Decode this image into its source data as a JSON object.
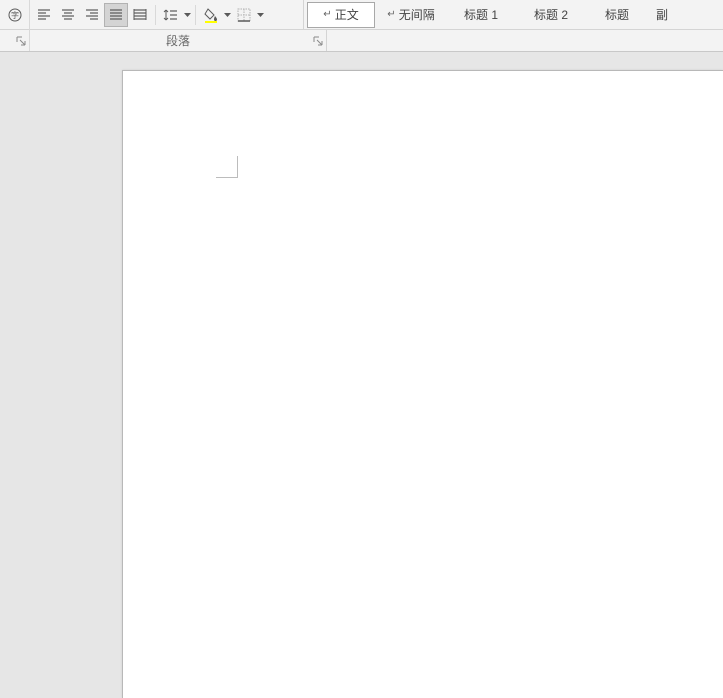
{
  "paragraph_group": {
    "label": "段落"
  },
  "styles": [
    {
      "label": "正文",
      "selected": true,
      "pilcrow": true
    },
    {
      "label": "无间隔",
      "selected": false,
      "pilcrow": true
    },
    {
      "label": "标题 1",
      "selected": false,
      "pilcrow": false
    },
    {
      "label": "标题 2",
      "selected": false,
      "pilcrow": false
    },
    {
      "label": "标题",
      "selected": false,
      "pilcrow": false
    },
    {
      "label": "副",
      "selected": false,
      "pilcrow": false
    }
  ]
}
